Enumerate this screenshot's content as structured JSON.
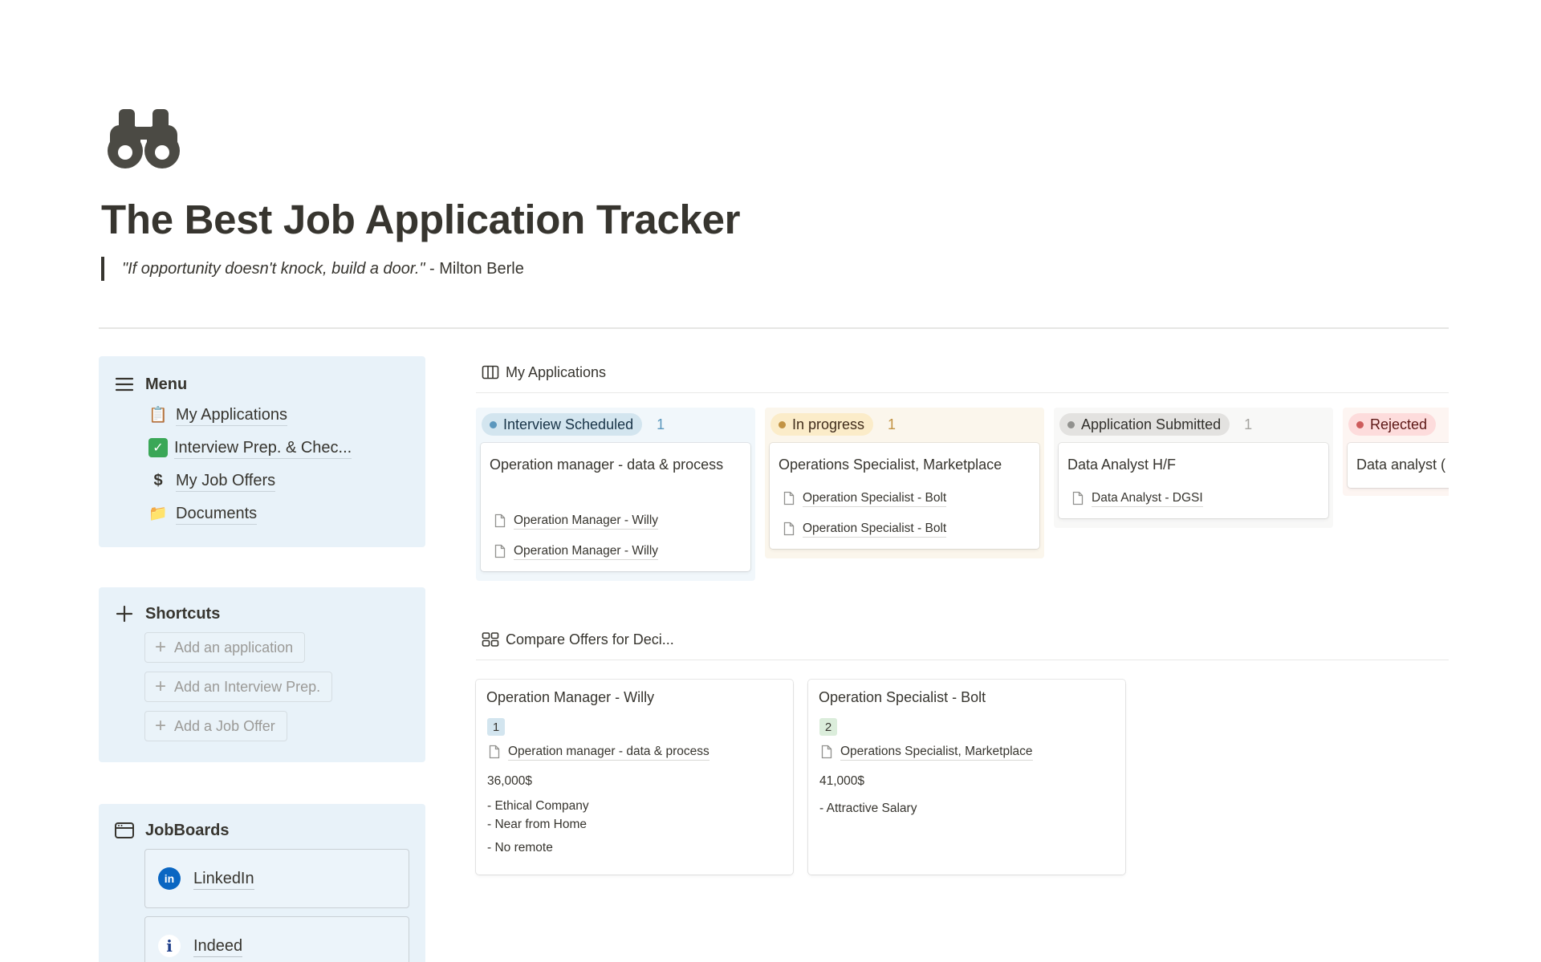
{
  "page": {
    "title": "The Best Job Application Tracker",
    "quote_italic": "\"If opportunity doesn't knock, build a door.\"",
    "quote_author": " - Milton Berle",
    "icon": "binoculars-icon"
  },
  "menu": {
    "label": "Menu",
    "items": [
      {
        "emoji": "📋",
        "label": "My Applications"
      },
      {
        "emoji": "✅",
        "label": "Interview Prep. & Chec..."
      },
      {
        "emoji": "$",
        "label": "My Job Offers"
      },
      {
        "emoji": "📁",
        "label": "Documents"
      }
    ]
  },
  "shortcuts": {
    "label": "Shortcuts",
    "buttons": [
      "Add an application",
      "Add an Interview Prep.",
      "Add a Job Offer"
    ]
  },
  "jobboards": {
    "label": "JobBoards",
    "items": [
      "LinkedIn",
      "Indeed"
    ]
  },
  "applications": {
    "title": "My Applications",
    "columns": [
      {
        "status": "Interview Scheduled",
        "count": "1",
        "colors": {
          "bg": "#f1f7fb",
          "pill": "#d3e5ef",
          "dot": "#5b97bd",
          "text": "#183347",
          "count": "#5b97bd"
        },
        "card": {
          "title": "Operation manager - data & process",
          "relations": [
            "Operation Manager - Willy",
            "Operation Manager - Willy"
          ]
        }
      },
      {
        "status": "In progress",
        "count": "1",
        "colors": {
          "bg": "#fbf6ec",
          "pill": "#fbecc9",
          "dot": "#c29343",
          "text": "#402c1b",
          "count": "#c29343"
        },
        "card": {
          "title": "Operations Specialist, Marketplace",
          "relations": [
            "Operation Specialist - Bolt",
            "Operation Specialist - Bolt"
          ]
        }
      },
      {
        "status": "Application Submitted",
        "count": "1",
        "colors": {
          "bg": "#f8f8f7",
          "pill": "#e3e2e0",
          "dot": "#91918e",
          "text": "#32302c",
          "count": "#a5a4a0"
        },
        "card": {
          "title": "Data Analyst H/F",
          "relations": [
            "Data Analyst - DGSI"
          ]
        }
      },
      {
        "status": "Rejected",
        "count": "",
        "colors": {
          "bg": "#fdf5f2",
          "pill": "#fddcdc",
          "dot": "#cd5c5c",
          "text": "#5d1715",
          "count": "#cd5c5c"
        },
        "card": {
          "title": "Data analyst (",
          "relations": []
        }
      }
    ]
  },
  "offers": {
    "title": "Compare Offers for Deci...",
    "cards": [
      {
        "title": "Operation Manager - Willy",
        "rank": "1",
        "rank_bg": "#d3e5ef",
        "relation": "Operation manager - data & process",
        "salary": "36,000$",
        "pros": [
          "- Ethical Company",
          "- Near from Home"
        ],
        "cons": [
          "- No remote"
        ]
      },
      {
        "title": "Operation Specialist - Bolt",
        "rank": "2",
        "rank_bg": "#dbeddb",
        "relation": "Operations Specialist, Marketplace",
        "salary": "41,000$",
        "pros": [
          "- Attractive Salary"
        ],
        "cons": []
      }
    ]
  }
}
